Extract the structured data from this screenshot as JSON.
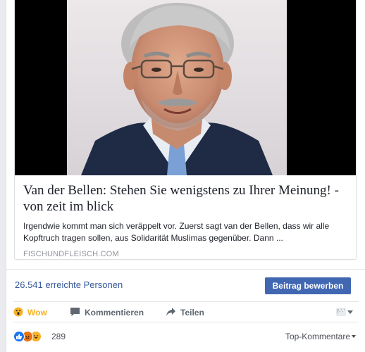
{
  "link_preview": {
    "image_alt": "photo-portrait",
    "title": "Van der Bellen: Stehen Sie wenigstens zu Ihrer Meinung! - von zeit im blick",
    "description": "Irgendwie kommt man sich veräppelt vor. Zuerst sagt van der Bellen, dass wir alle Kopftruch tragen sollen, aus Solidarität Muslimas gegenüber. Dann ...",
    "domain": "FISCHUNDFLEISCH.COM"
  },
  "reach": {
    "text": "26.541 erreichte Personen",
    "boost_label": "Beitrag bewerben"
  },
  "actions": {
    "wow_label": "Wow",
    "comment_label": "Kommentieren",
    "share_label": "Teilen",
    "reactors_text": "f·ʼ·ʼ"
  },
  "reactions": {
    "icons": [
      "like-icon",
      "angry-icon",
      "haha-icon"
    ],
    "count": "289",
    "sort_label": "Top-Kommentare"
  },
  "colors": {
    "accent": "#4267b2",
    "link": "#365899",
    "wow": "#f7b125",
    "muted": "#90949c"
  }
}
